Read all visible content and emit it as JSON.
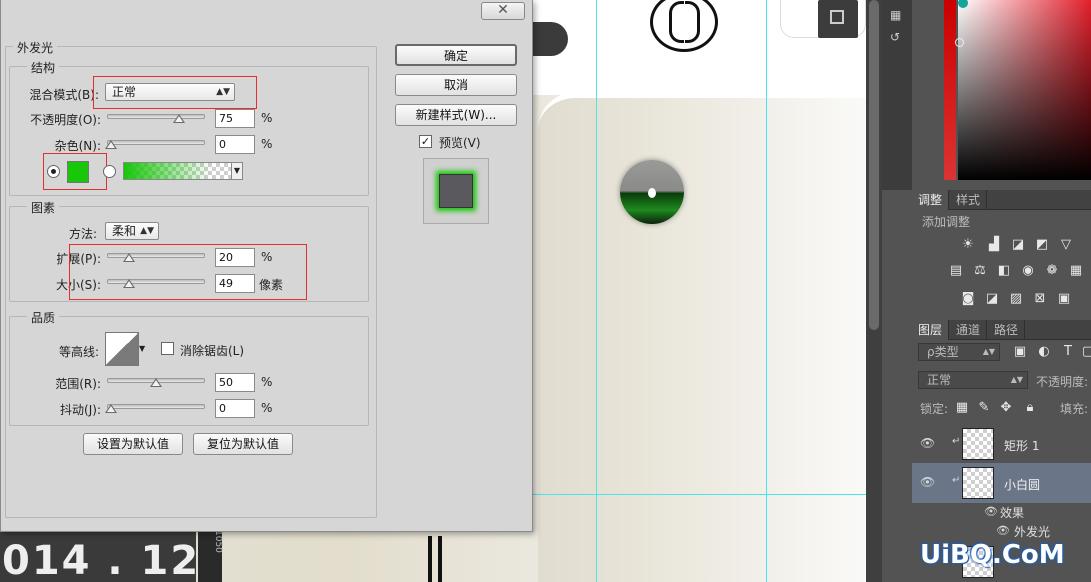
{
  "dialog": {
    "close_label": "✕",
    "section_title": "外发光",
    "structure": {
      "title": "结构",
      "blend_mode_label": "混合模式(B):",
      "blend_mode_value": "正常",
      "opacity_label": "不透明度(O):",
      "opacity_value": "75",
      "opacity_unit": "%",
      "opacity_level": 0.75,
      "noise_label": "杂色(N):",
      "noise_value": "0",
      "noise_unit": "%",
      "noise_level": 0,
      "glow_color": "#18c60a"
    },
    "elements": {
      "title": "图素",
      "technique_label": "方法:",
      "technique_value": "柔和",
      "spread_label": "扩展(P):",
      "spread_value": "20",
      "spread_unit": "%",
      "spread_level": 0.2,
      "size_label": "大小(S):",
      "size_value": "49",
      "size_unit": "像素",
      "size_level": 0.196
    },
    "quality": {
      "title": "品质",
      "contour_label": "等高线:",
      "anti_alias_label": "消除锯齿(L)",
      "range_label": "范围(R):",
      "range_value": "50",
      "range_unit": "%",
      "range_level": 0.5,
      "jitter_label": "抖动(J):",
      "jitter_value": "0",
      "jitter_unit": "%",
      "jitter_level": 0
    },
    "set_default_label": "设置为默认值",
    "reset_default_label": "复位为默认值",
    "ok_label": "确定",
    "cancel_label": "取消",
    "new_style_label": "新建样式(W)...",
    "preview_label": "预览(V)",
    "preview_checked": "✓"
  },
  "canvas": {
    "year_text": "014 . 12",
    "ruler_text": "1050"
  },
  "panel": {
    "adjust_tab": "调整",
    "styles_tab": "样式",
    "add_adjustment": "添加调整",
    "layers_tab": "图层",
    "channels_tab": "通道",
    "paths_tab": "路径",
    "kind_filter": "ρ类型",
    "blend_mode": "正常",
    "opacity_label": "不透明度:",
    "lock_label": "锁定:",
    "fill_label": "填充:",
    "layers": [
      {
        "name": "矩形 1"
      },
      {
        "name": "小白圆"
      }
    ],
    "effects_label": "效果",
    "outer_glow_label": "外发光"
  },
  "watermark": "UiBQ.CoM"
}
